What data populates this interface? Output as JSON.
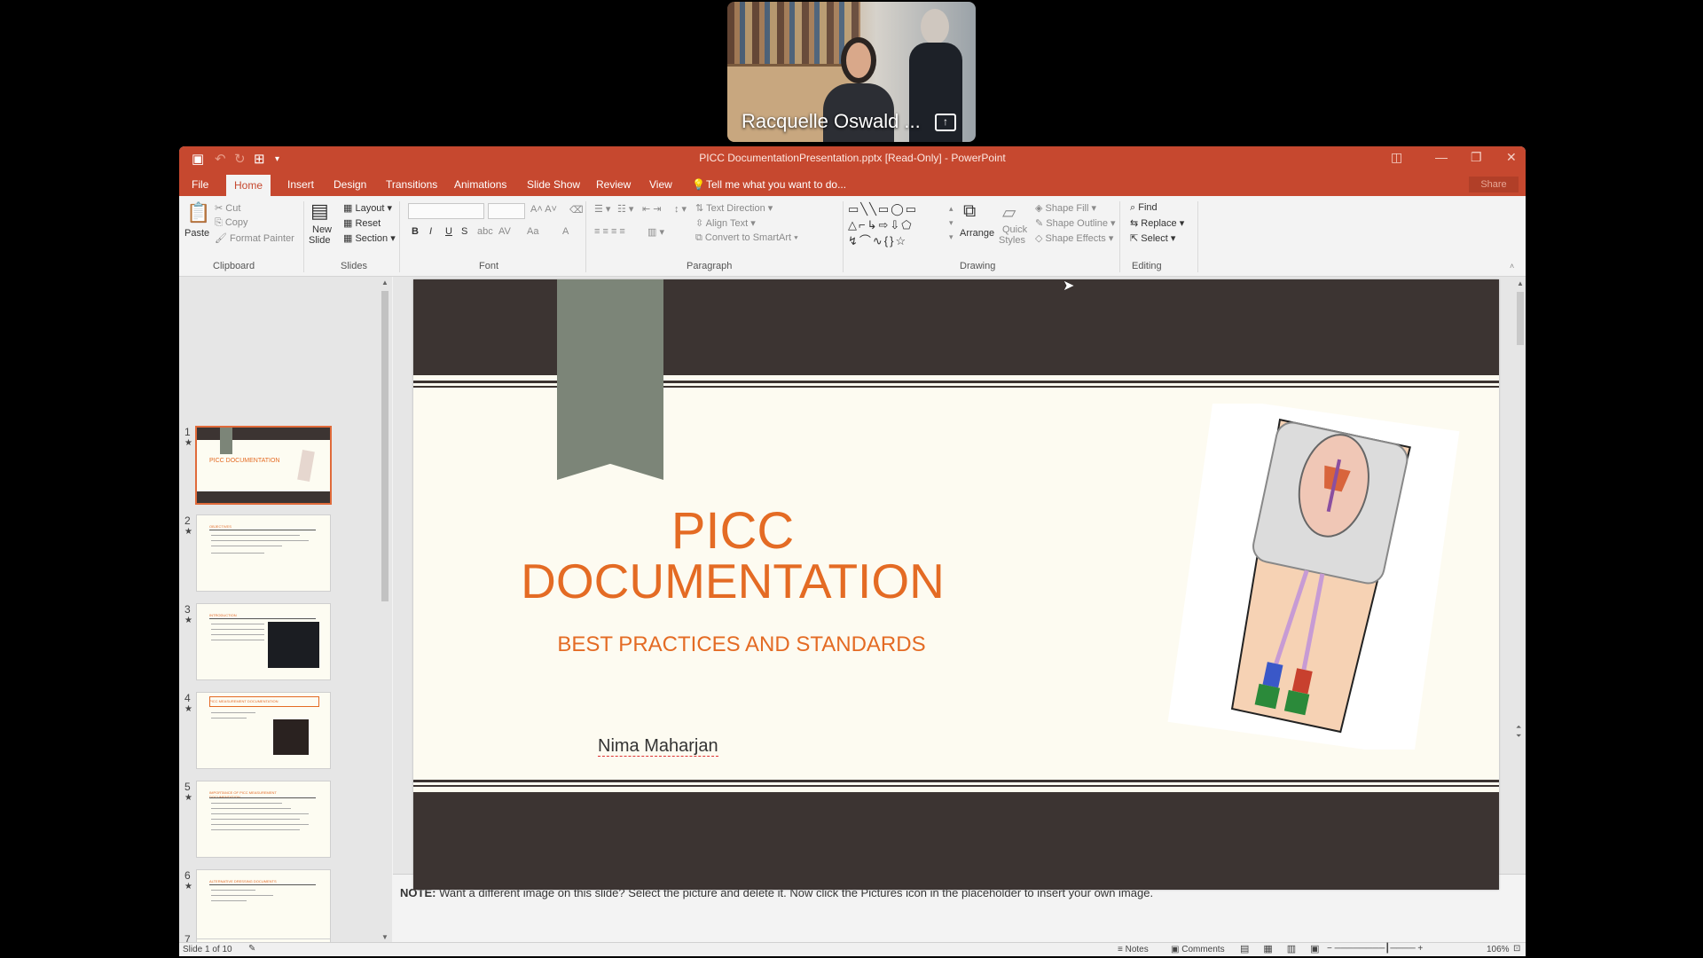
{
  "video": {
    "participant_name": "Racquelle Oswald ..."
  },
  "window": {
    "title": "PICC DocumentationPresentation.pptx [Read-Only] - PowerPoint",
    "share_label": "Share"
  },
  "tabs": [
    "File",
    "Home",
    "Insert",
    "Design",
    "Transitions",
    "Animations",
    "Slide Show",
    "Review",
    "View"
  ],
  "tell_me": "Tell me what you want to do...",
  "ribbon": {
    "clipboard": {
      "paste": "Paste",
      "cut": "Cut",
      "copy": "Copy",
      "format_painter": "Format Painter",
      "group": "Clipboard"
    },
    "slides": {
      "new_slide_1": "New",
      "new_slide_2": "Slide",
      "layout": "Layout",
      "reset": "Reset",
      "section": "Section",
      "group": "Slides"
    },
    "font": {
      "group": "Font"
    },
    "paragraph": {
      "text_direction": "Text Direction",
      "align_text": "Align Text",
      "convert_smartart": "Convert to SmartArt",
      "group": "Paragraph"
    },
    "drawing": {
      "arrange": "Arrange",
      "quick_styles_1": "Quick",
      "quick_styles_2": "Styles",
      "shape_fill": "Shape Fill",
      "shape_outline": "Shape Outline",
      "shape_effects": "Shape Effects",
      "group": "Drawing"
    },
    "editing": {
      "find": "Find",
      "replace": "Replace",
      "select": "Select",
      "group": "Editing"
    }
  },
  "thumbnails": [
    {
      "num": "1",
      "title": "PICC DOCUMENTATION"
    },
    {
      "num": "2",
      "title": "OBJECTIVES"
    },
    {
      "num": "3",
      "title": "INTRODUCTION"
    },
    {
      "num": "4",
      "title": "PICC MEASUREMENT DOCUMENTATION"
    },
    {
      "num": "5",
      "title": "IMPORTANCE OF PICC MEASUREMENT DOCUMENTATION"
    },
    {
      "num": "6",
      "title": "ALTERNATIVE DRESSING DOCUMENTS"
    },
    {
      "num": "7",
      "title": ""
    }
  ],
  "slide": {
    "title_line1": "PICC",
    "title_line2": "DOCUMENTATION",
    "subtitle": "BEST PRACTICES AND STANDARDS",
    "author": "Nima Maharjan"
  },
  "notes": {
    "label": "NOTE:",
    "text": " Want a different image on this slide? Select the picture and delete it. Now click the Pictures icon in the placeholder to insert your own image."
  },
  "status": {
    "slide_count": "Slide 1 of 10",
    "notes": "Notes",
    "comments": "Comments",
    "zoom": "106%"
  },
  "colors": {
    "accent": "#c6482f",
    "slide_title": "#e46b24",
    "slide_band": "#3c3432"
  }
}
